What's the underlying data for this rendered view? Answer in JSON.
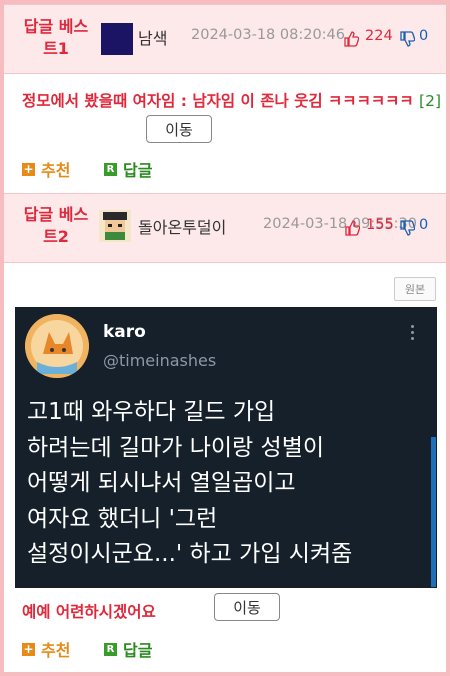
{
  "best1": {
    "label": "답글 베스트1",
    "nickname": "남색",
    "datetime": "2024-03-18 08:20:46",
    "up_count": "224",
    "down_count": "0",
    "title": "정모에서 봤을때 여자임 : 남자임 이 존나 웃김 ㅋㅋㅋㅋㅋㅋ",
    "comment_count": "[2]",
    "move_label": "이동",
    "recommend_label": "추천",
    "reply_label": "답글",
    "avatar_color": "#1b1464"
  },
  "best2": {
    "label": "답글 베스트2",
    "nickname": "돌아온투덜이",
    "datetime": "2024-03-18 09:55:30",
    "up_count": "155",
    "down_count": "0",
    "original_label": "원본",
    "tweet": {
      "name": "karo",
      "handle": "@timeinashes",
      "text": "고1때 와우하다 길드 가입\n하려는데 길마가 나이랑 성별이\n어떻게 되시냐서 열일곱이고\n여자요 했더니 '그런\n설정이시군요...' 하고 가입 시켜줌"
    },
    "caption": "예예 어련하시겠어요",
    "move_label": "이동",
    "recommend_label": "추천",
    "reply_label": "답글"
  },
  "colors": {
    "accent_red": "#e0283b",
    "header_bg": "#fde8ea",
    "tweet_bg": "#15202b",
    "frame_border": "#f7bcc0"
  }
}
